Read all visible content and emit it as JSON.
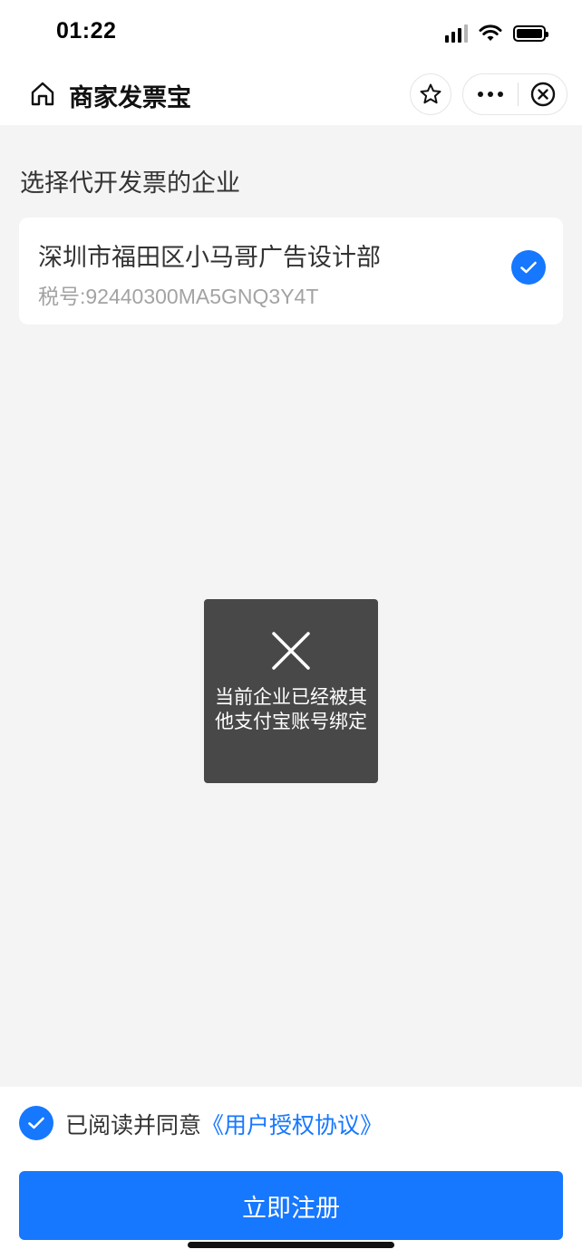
{
  "status_bar": {
    "time": "01:22"
  },
  "nav": {
    "title": "商家发票宝",
    "icons": [
      "home-icon",
      "star-icon",
      "more-icon",
      "close-circle-icon"
    ]
  },
  "main": {
    "section_title": "选择代开发票的企业",
    "company": {
      "name": "深圳市福田区小马哥广告设计部",
      "tax_id": "税号:92440300MA5GNQ3Y4T",
      "selected": true
    }
  },
  "toast": {
    "icon": "close-icon",
    "message": "当前企业已经被其他支付宝账号绑定"
  },
  "footer": {
    "agree_checked": true,
    "agree_prefix": "已阅读并同意",
    "agree_link": "《用户授权协议》",
    "register_label": "立即注册"
  },
  "colors": {
    "accent": "#1677ff",
    "page_bg": "#f4f4f4",
    "toast_bg": "#484848"
  }
}
